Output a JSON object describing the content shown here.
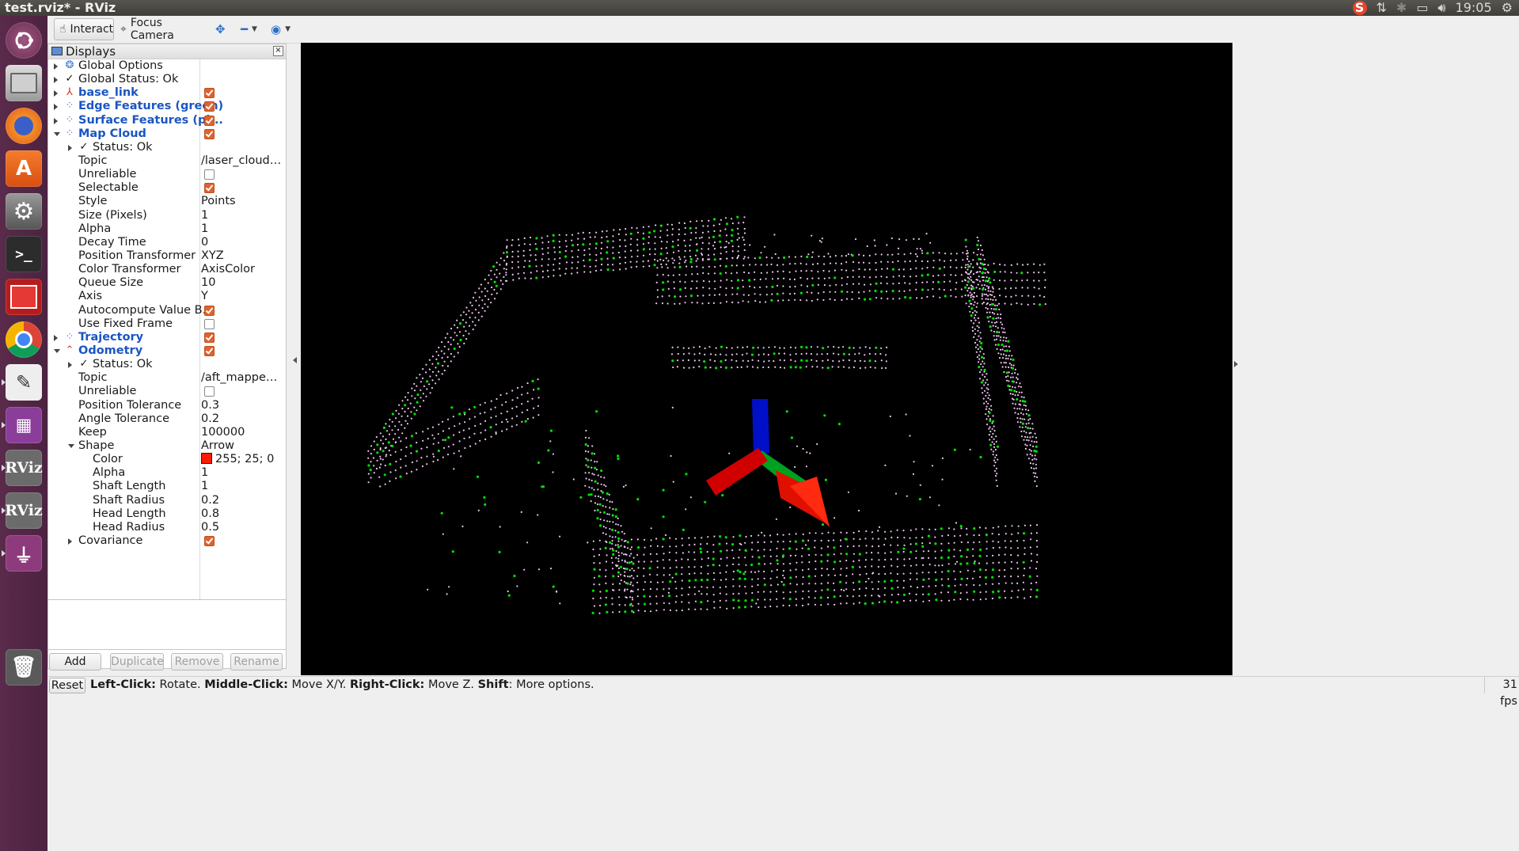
{
  "window_title": "test.rviz* - RViz",
  "tray": {
    "clock": "19:05"
  },
  "toolbar": {
    "interact": "Interact",
    "focus_camera": "Focus Camera"
  },
  "panel": {
    "title": "Displays"
  },
  "tree": {
    "global_options": "Global Options",
    "global_status": "Global Status: Ok",
    "base_link": "base_link",
    "edge_features": "Edge Features (green)",
    "surface_features": "Surface Features (pi...",
    "map_cloud": "Map Cloud",
    "map_status": "Status: Ok",
    "map_props": [
      {
        "k": "Topic",
        "v": "/laser_cloud_..."
      },
      {
        "k": "Unreliable",
        "cb": false
      },
      {
        "k": "Selectable",
        "cb": true
      },
      {
        "k": "Style",
        "v": "Points"
      },
      {
        "k": "Size (Pixels)",
        "v": "1"
      },
      {
        "k": "Alpha",
        "v": "1"
      },
      {
        "k": "Decay Time",
        "v": "0"
      },
      {
        "k": "Position Transformer",
        "v": "XYZ"
      },
      {
        "k": "Color Transformer",
        "v": "AxisColor"
      },
      {
        "k": "Queue Size",
        "v": "10"
      },
      {
        "k": "Axis",
        "v": "Y"
      },
      {
        "k": "Autocompute Value B...",
        "cb": true
      },
      {
        "k": "Use Fixed Frame",
        "cb": false
      }
    ],
    "trajectory": "Trajectory",
    "odometry": "Odometry",
    "odo_status": "Status: Ok",
    "odo_props": [
      {
        "k": "Topic",
        "v": "/aft_mapped_..."
      },
      {
        "k": "Unreliable",
        "cb": false
      },
      {
        "k": "Position Tolerance",
        "v": "0.3"
      },
      {
        "k": "Angle Tolerance",
        "v": "0.2"
      },
      {
        "k": "Keep",
        "v": "100000"
      }
    ],
    "shape_label": "Shape",
    "shape_value": "Arrow",
    "shape_props": [
      {
        "k": "Color",
        "v": "255; 25; 0",
        "swatch": "#ff1900"
      },
      {
        "k": "Alpha",
        "v": "1"
      },
      {
        "k": "Shaft Length",
        "v": "1"
      },
      {
        "k": "Shaft Radius",
        "v": "0.2"
      },
      {
        "k": "Head Length",
        "v": "0.8"
      },
      {
        "k": "Head Radius",
        "v": "0.5"
      }
    ],
    "covariance": "Covariance"
  },
  "buttons": {
    "add": "Add",
    "duplicate": "Duplicate",
    "remove": "Remove",
    "rename": "Rename"
  },
  "status": {
    "reset": "Reset",
    "left_click": "Left-Click:",
    "left_text": " Rotate. ",
    "middle_click": "Middle-Click:",
    "middle_text": " Move X/Y. ",
    "right_click": "Right-Click:",
    "right_text": " Move Z. ",
    "shift": "Shift",
    "shift_text": ": More options.",
    "fps": "31 fps"
  },
  "colors": {
    "edge_points": "#00e000",
    "surface_points": "#f0c8f0",
    "arrow": "#ff1900",
    "launcher": "#4b2340"
  },
  "icons": [
    "ubuntu-dash-icon",
    "files-icon",
    "firefox-icon",
    "software-center-icon",
    "settings-icon",
    "terminal-icon",
    "app-red-icon",
    "chrome-icon",
    "text-editor-icon",
    "workspace-icon",
    "rviz-icon",
    "rviz-icon",
    "usb-icon",
    "trash-icon"
  ]
}
